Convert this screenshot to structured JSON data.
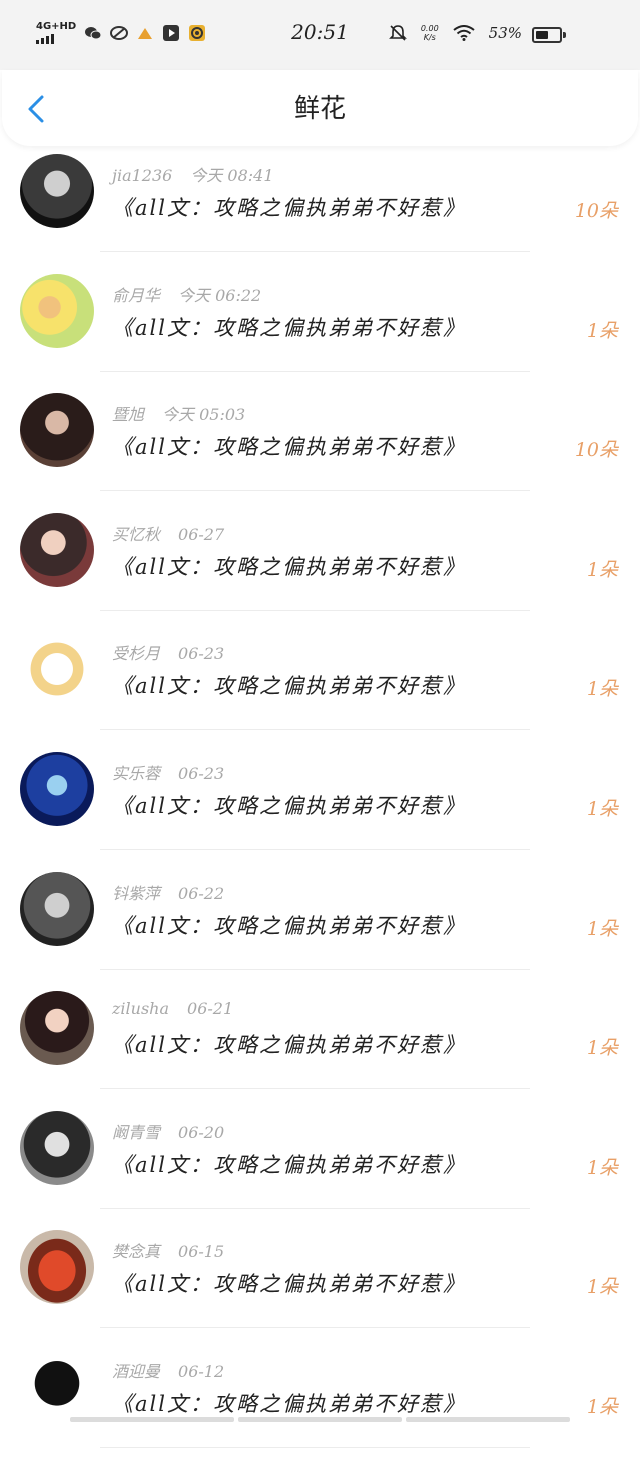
{
  "statusbar": {
    "network": "4G+HD",
    "time": "20:51",
    "net_speed_top": "0.00",
    "net_speed_bottom": "K/s",
    "battery_pct": "53%",
    "battery_level": 0.53
  },
  "header": {
    "title": "鲜花"
  },
  "colors": {
    "accent_blue": "#2b8fe6",
    "count_orange": "#e8a068",
    "meta_gray": "#a8a8a8"
  },
  "items": [
    {
      "user": "jia1236",
      "time": "今天 08:41",
      "book": "《all文：攻略之偏执弟弟不好惹》",
      "count": "10朵"
    },
    {
      "user": "俞月华",
      "time": "今天 06:22",
      "book": "《all文：攻略之偏执弟弟不好惹》",
      "count": "1朵"
    },
    {
      "user": "暨旭",
      "time": "今天 05:03",
      "book": "《all文：攻略之偏执弟弟不好惹》",
      "count": "10朵"
    },
    {
      "user": "买忆秋",
      "time": "06-27",
      "book": "《all文：攻略之偏执弟弟不好惹》",
      "count": "1朵"
    },
    {
      "user": "受杉月",
      "time": "06-23",
      "book": "《all文：攻略之偏执弟弟不好惹》",
      "count": "1朵"
    },
    {
      "user": "实乐蓉",
      "time": "06-23",
      "book": "《all文：攻略之偏执弟弟不好惹》",
      "count": "1朵"
    },
    {
      "user": "钭紫萍",
      "time": "06-22",
      "book": "《all文：攻略之偏执弟弟不好惹》",
      "count": "1朵"
    },
    {
      "user": "zilusha",
      "time": "06-21",
      "book": "《all文：攻略之偏执弟弟不好惹》",
      "count": "1朵"
    },
    {
      "user": "阚青雪",
      "time": "06-20",
      "book": "《all文：攻略之偏执弟弟不好惹》",
      "count": "1朵"
    },
    {
      "user": "樊念真",
      "time": "06-15",
      "book": "《all文：攻略之偏执弟弟不好惹》",
      "count": "1朵"
    },
    {
      "user": "酒迎曼",
      "time": "06-12",
      "book": "《all文：攻略之偏执弟弟不好惹》",
      "count": "1朵"
    }
  ]
}
